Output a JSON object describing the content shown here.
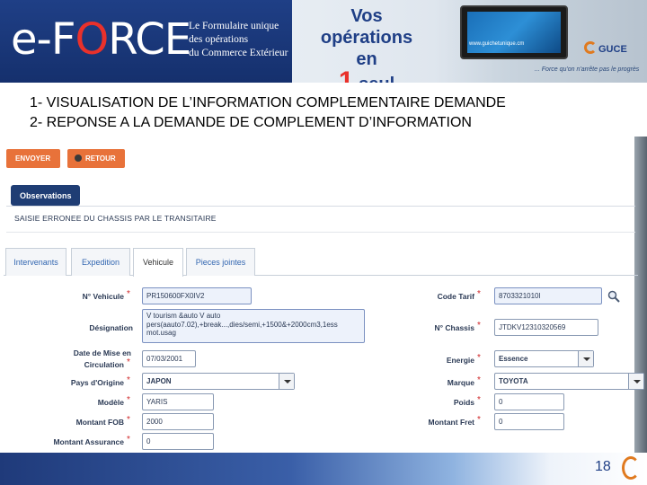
{
  "banner": {
    "logo_prefix": "e-F",
    "logo_o": "O",
    "logo_suffix": "RCE",
    "tagline_1": "Le Formulaire unique",
    "tagline_2": "des opérations",
    "tagline_3": "du Commerce Extérieur",
    "promo_1": "Vos opérations",
    "promo_2": "en",
    "promo_3_num": "1",
    "promo_3_text": "seul formulaire",
    "tablet_url": "www.guichetunique.cm",
    "guce_label": "GUCE",
    "slogan": "... Force qu'on n'arrête pas le progrès"
  },
  "steps": {
    "step_1": "1- VISUALISATION DE L’INFORMATION COMPLEMENTAIRE DEMANDE",
    "step_2": "2- REPONSE A LA DEMANDE DE COMPLEMENT D’INFORMATION"
  },
  "toolbar": {
    "envoyer_label": "ENVOYER",
    "retour_label": "RETOUR"
  },
  "observations": {
    "button_label": "Observations",
    "text": "SAISIE ERRONEE DU CHASSIS PAR LE TRANSITAIRE"
  },
  "tabs": [
    {
      "label": "Intervenants"
    },
    {
      "label": "Expedition"
    },
    {
      "label": "Vehicule"
    },
    {
      "label": "Pieces jointes"
    }
  ],
  "form": {
    "required_marker": "*",
    "no_vehicule": {
      "label": "N° Vehicule",
      "value": "PR150600FX0IV2"
    },
    "designation": {
      "label": "Désignation",
      "value": "V tourism &auto V auto pers(aauto7.02),+break...,dies/semi,+1500&+2000cm3,1ess mot.usag"
    },
    "date_mise_circulation": {
      "label_1": "Date de Mise en",
      "label_2": "Circulation",
      "value": "07/03/2001"
    },
    "pays_origine": {
      "label": "Pays d'Origine",
      "value": "JAPON"
    },
    "modele": {
      "label": "Modèle",
      "value": "YARIS"
    },
    "montant_fob": {
      "label": "Montant FOB",
      "value": "2000"
    },
    "montant_assurance": {
      "label": "Montant Assurance",
      "value": "0"
    },
    "code_tarif": {
      "label": "Code Tarif",
      "value": "8703321010I"
    },
    "no_chassis": {
      "label": "N° Chassis",
      "value": "JTDKV12310320569"
    },
    "energie": {
      "label": "Energie",
      "value": "Essence"
    },
    "marque": {
      "label": "Marque",
      "value": "TOYOTA"
    },
    "poids": {
      "label": "Poids",
      "value": "0"
    },
    "montant_fret": {
      "label": "Montant Fret",
      "value": "0"
    }
  },
  "footer": {
    "page_number": "18"
  }
}
